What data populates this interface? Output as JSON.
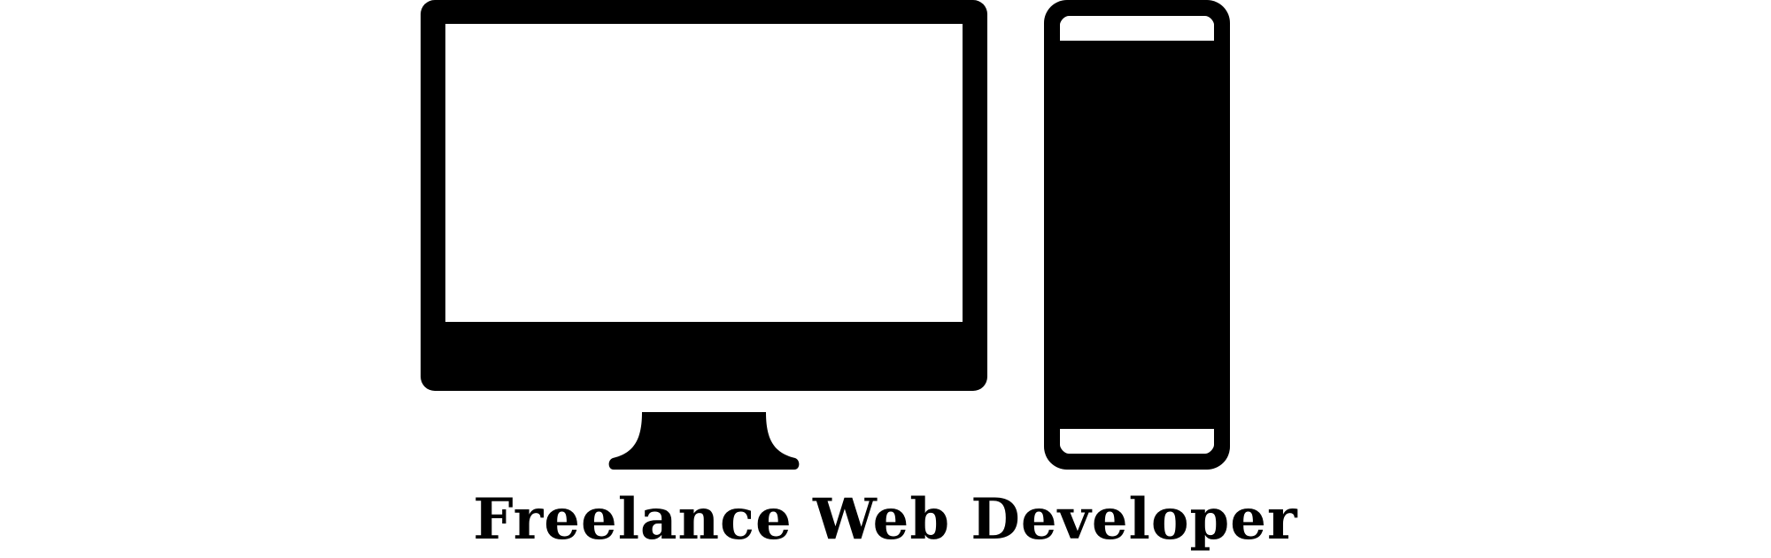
{
  "logo": {
    "tagline": "Freelance Web Developer",
    "icons": [
      "monitor-icon",
      "tower-pc-icon"
    ],
    "colors": {
      "foreground": "#000000",
      "background": "#ffffff"
    }
  }
}
